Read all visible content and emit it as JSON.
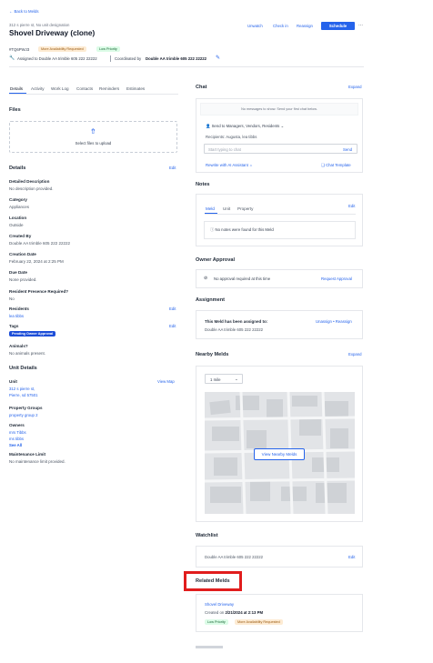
{
  "back_link": "Back to Melds",
  "address_line": "312 s pierre st, No unit designation",
  "title": "Shovel Driveway (clone)",
  "header_actions": {
    "unwatch": "Unwatch",
    "check_in": "Check in",
    "reassign": "Reassign",
    "schedule": "Schedule",
    "more": "..."
  },
  "meld_id": "#TQ6PWJ3",
  "top_badges": [
    "More Availability Requested",
    "Low Priority"
  ],
  "assigned_to_prefix": "Assigned to Double AA trimble 605 222 22222",
  "coordinated_prefix": "Coordinated by",
  "coordinated_name": "Double AA trimble 605 222 22222",
  "tabs": [
    "Details",
    "Activity",
    "Work Log",
    "Contacts",
    "Reminders",
    "Estimates"
  ],
  "files": {
    "title": "Files",
    "upload_text": "Select files to upload"
  },
  "details": {
    "title": "Details",
    "edit": "Edit",
    "items": [
      {
        "label": "Detailed Description",
        "value": "No description provided."
      },
      {
        "label": "Category",
        "value": "Appliances"
      },
      {
        "label": "Location",
        "value": "Outside"
      },
      {
        "label": "Created By",
        "value": "Double AA trimble 605 222 22222"
      },
      {
        "label": "Creation Date",
        "value": "February 22, 2024 at 2:25 PM"
      },
      {
        "label": "Due Date",
        "value": "None provided."
      },
      {
        "label": "Resident Presence Required?",
        "value": "No"
      }
    ],
    "residents_label": "Residents",
    "residents_edit": "Edit",
    "residents_value": "lea tibbs",
    "tags_label": "Tags",
    "tags_edit": "Edit",
    "tag_value": "Pending Owner Approval",
    "animals_label": "Animals?",
    "animals_value": "No animals present."
  },
  "unit_details": {
    "title": "Unit Details",
    "unit_label": "Unit",
    "view_map": "View Map",
    "unit_line1": "312 s pierre st,",
    "unit_line2": "Pierre, sd 57501",
    "pg_label": "Property Groups",
    "pg_value": "property group 2",
    "owners_label": "Owners",
    "owners": [
      "mrs Tibbs",
      "ms tibbs"
    ],
    "see_all": "See All",
    "mlimit_label": "Maintenance Limit",
    "mlimit_value": "No maintenance limit provided."
  },
  "chat": {
    "title": "Chat",
    "expand": "Expand",
    "empty": "No messages to show. Send your first chat below.",
    "send_to": "Send to Managers, Vendors, Residents",
    "recipients": "Recipients: Augusta, lea tibbs",
    "placeholder": "Start typing to chat",
    "send": "Send",
    "rewrite": "Rewrite with AI Assistant",
    "template": "Chat Template"
  },
  "notes": {
    "title": "Notes",
    "tabs": [
      "Meld",
      "Unit",
      "Property"
    ],
    "edit": "Edit",
    "empty": "No notes were found for this Meld"
  },
  "owner_approval": {
    "title": "Owner Approval",
    "text": "No approval required at this time",
    "request": "Request Approval"
  },
  "assignment": {
    "title": "Assignment",
    "heading": "This Meld has been assigned to:",
    "name": "Double AA trimble 605 222 22222",
    "action": "Unassign • Reassign"
  },
  "nearby": {
    "title": "Nearby Melds",
    "expand": "Expand",
    "select": "1 mile",
    "button": "View Nearby Melds"
  },
  "watchlist": {
    "title": "Watchlist",
    "name": "Double AA trimble 605 222 22222",
    "edit": "Edit"
  },
  "related": {
    "title": "Related Melds",
    "item_title": "Shovel Driveway",
    "created_prefix": "Created on",
    "created_date": "2/21/2024 at 2:13 PM",
    "badges": [
      "Low Priority",
      "More Availability Requested"
    ]
  },
  "colors": {
    "accent": "#2563eb",
    "highlight": "#e11d1d"
  }
}
